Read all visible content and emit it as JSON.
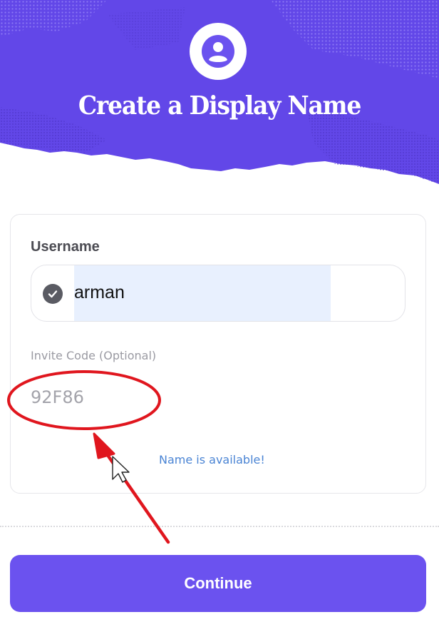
{
  "header": {
    "title": "Create a Display Name"
  },
  "form": {
    "username_label": "Username",
    "username_value": "arman",
    "invite_label": "Invite Code (Optional)",
    "invite_value": "92F86",
    "status": "Name is available!"
  },
  "actions": {
    "continue_label": "Continue"
  },
  "icons": {
    "avatar": "user-avatar-icon",
    "check": "check-circle-icon",
    "cursor": "mouse-pointer-icon"
  },
  "colors": {
    "banner": "#6247e8",
    "accent": "#6b52ef",
    "status": "#4a84d4",
    "annotation": "#e0161e"
  }
}
